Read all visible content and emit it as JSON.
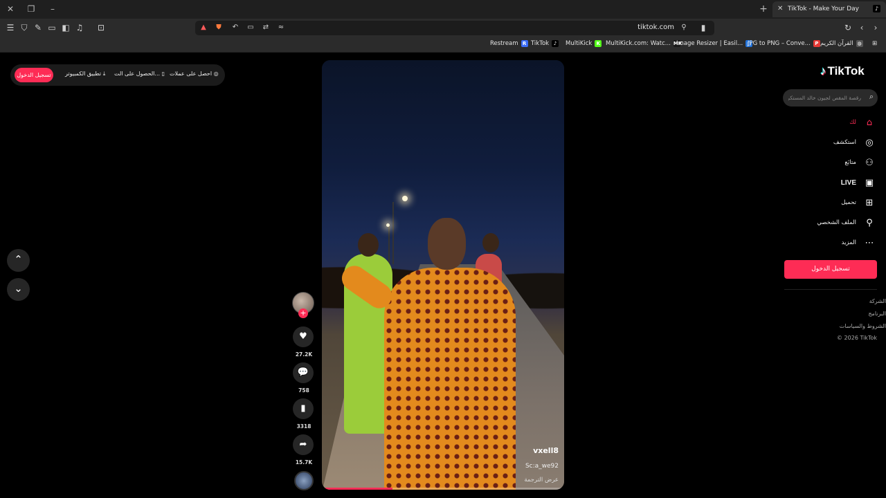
{
  "browser": {
    "tab_title": "TikTok - Make Your Day",
    "url": "tiktok.com",
    "bookmarks": [
      {
        "label": "Restream",
        "icon": "R",
        "color": "#3b6cf6"
      },
      {
        "label": "TikTok",
        "icon": "♪",
        "color": "#000000"
      },
      {
        "label": "MultiKick",
        "icon": "K",
        "color": "#53fc18"
      },
      {
        "label": "MultiKick.com: Watc...",
        "icon": "MK",
        "color": "#1a1a1a"
      },
      {
        "label": "Image Resizer | Easil...",
        "icon": "▢",
        "color": "#1d6fd8"
      },
      {
        "label": "JPG to PNG – Conve...",
        "icon": "P",
        "color": "#e53935"
      },
      {
        "label": "القرآن الكريم",
        "icon": "◍",
        "color": "#555555"
      }
    ]
  },
  "promo": {
    "login": "تسجيل الدخول",
    "desktop_app": "تطبيق الكمبيوتر",
    "get_app": "الحصول على الت...",
    "get_coins": "احصل على عملات"
  },
  "video": {
    "username": "vxell8",
    "sound": "Sc:a_we92",
    "translate": "عرض الترجمة",
    "progress": 0.29
  },
  "actions": {
    "likes": "27.2K",
    "comments": "758",
    "saves": "3318",
    "shares": "15.7K"
  },
  "sidebar": {
    "logo": "TikTok",
    "search_placeholder": "رقصة المقص لجيون خالد المستكر",
    "menu": [
      {
        "label": "لك",
        "icon": "home-icon"
      },
      {
        "label": "استكشف",
        "icon": "compass-icon"
      },
      {
        "label": "متابَع",
        "icon": "user-add-icon"
      },
      {
        "label": "LIVE",
        "icon": "live-icon"
      },
      {
        "label": "تحميل",
        "icon": "upload-icon"
      },
      {
        "label": "الملف الشخصي",
        "icon": "profile-icon"
      },
      {
        "label": "المزيد",
        "icon": "more-icon"
      }
    ],
    "login": "تسجيل الدخول",
    "footer": [
      "الشركة",
      "البرنامج",
      "الشروط والسياسات",
      "© 2026 TikTok"
    ]
  },
  "colors": {
    "accent": "#fe2c55",
    "background": "#000000"
  }
}
